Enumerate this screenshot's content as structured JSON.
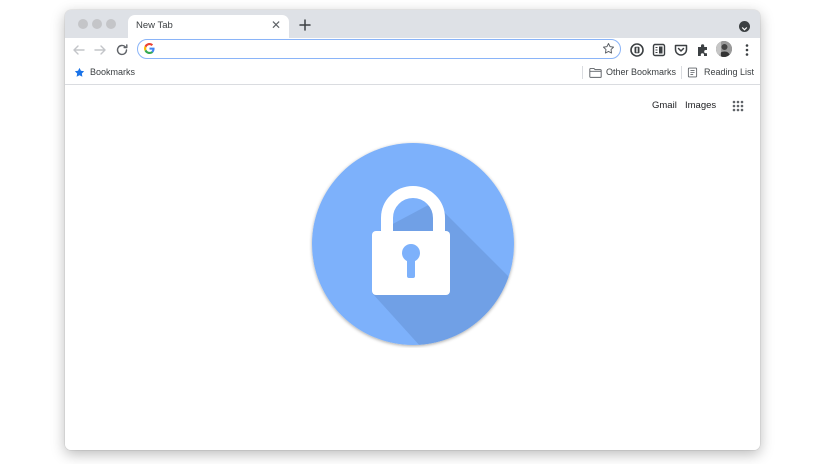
{
  "window": {
    "tab": {
      "title": "New Tab",
      "close_icon": "close-icon"
    },
    "new_tab_icon": "plus-icon",
    "tab_search_icon": "chevron-down-circle-icon"
  },
  "toolbar": {
    "back_icon": "back-arrow-icon",
    "forward_icon": "forward-arrow-icon",
    "reload_icon": "reload-icon",
    "omnibox": {
      "value": "",
      "placeholder": "",
      "leading_icon": "google-g-icon",
      "trailing_icon": "star-icon"
    },
    "extensions": [
      "extension-1-icon",
      "reader-mode-icon",
      "pocket-icon",
      "puzzle-icon"
    ],
    "profile_icon": "avatar",
    "menu_icon": "kebab-menu-icon"
  },
  "bookmarks_bar": {
    "bookmarks_label": "Bookmarks",
    "other_bookmarks_label": "Other Bookmarks",
    "reading_list_label": "Reading List"
  },
  "ntp": {
    "gmail_label": "Gmail",
    "images_label": "Images",
    "apps_icon": "apps-grid-icon",
    "hero_icon": "lock-icon"
  },
  "colors": {
    "tabstrip": "#dee1e6",
    "omnibox_focus": "#8ab4f8",
    "lock_circle": "#7db1fb",
    "lock_shadow": "#6f9fe3",
    "star_blue": "#1a73e8"
  }
}
